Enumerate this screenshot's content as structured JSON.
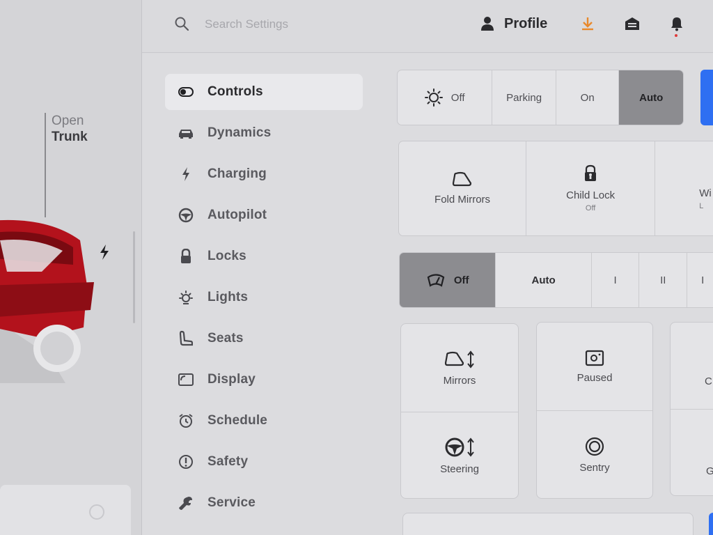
{
  "search": {
    "placeholder": "Search Settings"
  },
  "header": {
    "profile_label": "Profile",
    "icons": [
      "search-icon",
      "person-icon",
      "download-icon",
      "garage-icon",
      "bell-icon"
    ],
    "download_color": "#e8892c",
    "notification_dot_color": "#e03b3b"
  },
  "car": {
    "trunk_action": "Open",
    "trunk_label": "Trunk",
    "body_color": "#b3121c",
    "charging_icon": "bolt-icon"
  },
  "nav": {
    "items": [
      {
        "label": "Controls",
        "icon": "toggle-icon",
        "active": true
      },
      {
        "label": "Dynamics",
        "icon": "car-icon"
      },
      {
        "label": "Charging",
        "icon": "bolt-icon"
      },
      {
        "label": "Autopilot",
        "icon": "steering-wheel-icon"
      },
      {
        "label": "Locks",
        "icon": "lock-icon"
      },
      {
        "label": "Lights",
        "icon": "light-icon"
      },
      {
        "label": "Seats",
        "icon": "seat-icon"
      },
      {
        "label": "Display",
        "icon": "display-icon"
      },
      {
        "label": "Schedule",
        "icon": "alarm-clock-icon"
      },
      {
        "label": "Safety",
        "icon": "alert-circle-icon"
      },
      {
        "label": "Service",
        "icon": "wrench-icon"
      }
    ]
  },
  "lights_mode": {
    "options": [
      "Off",
      "Parking",
      "On",
      "Auto"
    ],
    "selected": "Auto"
  },
  "quick_tiles": [
    {
      "label": "Fold Mirrors",
      "icon": "mirror-icon"
    },
    {
      "label": "Child Lock",
      "sub": "Off",
      "icon": "child-lock-icon"
    },
    {
      "label": "Wi",
      "sub": "L"
    }
  ],
  "wiper_mode": {
    "options": [
      "Off",
      "Auto",
      "I",
      "II",
      "I"
    ],
    "selected": "Off"
  },
  "adjust_cards": [
    {
      "label": "Mirrors",
      "icon": "mirror-adjust-icon"
    },
    {
      "label": "Steering",
      "icon": "steering-adjust-icon"
    }
  ],
  "dashcam_cards": [
    {
      "label": "Paused",
      "icon": "dashcam-icon"
    },
    {
      "label": "Sentry",
      "icon": "sentry-icon"
    }
  ],
  "cut_cards": [
    "C",
    "G"
  ],
  "accent_color": "#2e6ff2"
}
